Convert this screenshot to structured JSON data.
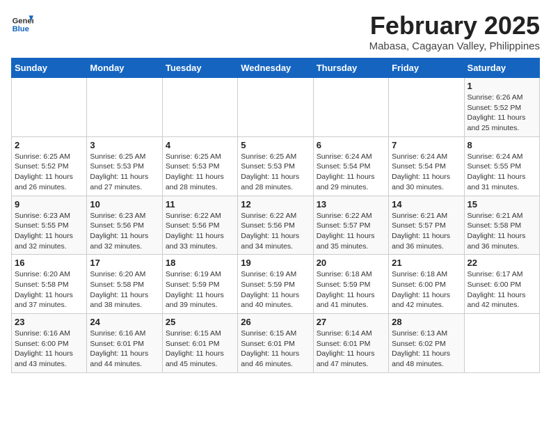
{
  "header": {
    "logo_general": "General",
    "logo_blue": "Blue",
    "title": "February 2025",
    "subtitle": "Mabasa, Cagayan Valley, Philippines"
  },
  "weekdays": [
    "Sunday",
    "Monday",
    "Tuesday",
    "Wednesday",
    "Thursday",
    "Friday",
    "Saturday"
  ],
  "weeks": [
    [
      {
        "day": "",
        "info": ""
      },
      {
        "day": "",
        "info": ""
      },
      {
        "day": "",
        "info": ""
      },
      {
        "day": "",
        "info": ""
      },
      {
        "day": "",
        "info": ""
      },
      {
        "day": "",
        "info": ""
      },
      {
        "day": "1",
        "info": "Sunrise: 6:26 AM\nSunset: 5:52 PM\nDaylight: 11 hours and 25 minutes."
      }
    ],
    [
      {
        "day": "2",
        "info": "Sunrise: 6:25 AM\nSunset: 5:52 PM\nDaylight: 11 hours and 26 minutes."
      },
      {
        "day": "3",
        "info": "Sunrise: 6:25 AM\nSunset: 5:53 PM\nDaylight: 11 hours and 27 minutes."
      },
      {
        "day": "4",
        "info": "Sunrise: 6:25 AM\nSunset: 5:53 PM\nDaylight: 11 hours and 28 minutes."
      },
      {
        "day": "5",
        "info": "Sunrise: 6:25 AM\nSunset: 5:53 PM\nDaylight: 11 hours and 28 minutes."
      },
      {
        "day": "6",
        "info": "Sunrise: 6:24 AM\nSunset: 5:54 PM\nDaylight: 11 hours and 29 minutes."
      },
      {
        "day": "7",
        "info": "Sunrise: 6:24 AM\nSunset: 5:54 PM\nDaylight: 11 hours and 30 minutes."
      },
      {
        "day": "8",
        "info": "Sunrise: 6:24 AM\nSunset: 5:55 PM\nDaylight: 11 hours and 31 minutes."
      }
    ],
    [
      {
        "day": "9",
        "info": "Sunrise: 6:23 AM\nSunset: 5:55 PM\nDaylight: 11 hours and 32 minutes."
      },
      {
        "day": "10",
        "info": "Sunrise: 6:23 AM\nSunset: 5:56 PM\nDaylight: 11 hours and 32 minutes."
      },
      {
        "day": "11",
        "info": "Sunrise: 6:22 AM\nSunset: 5:56 PM\nDaylight: 11 hours and 33 minutes."
      },
      {
        "day": "12",
        "info": "Sunrise: 6:22 AM\nSunset: 5:56 PM\nDaylight: 11 hours and 34 minutes."
      },
      {
        "day": "13",
        "info": "Sunrise: 6:22 AM\nSunset: 5:57 PM\nDaylight: 11 hours and 35 minutes."
      },
      {
        "day": "14",
        "info": "Sunrise: 6:21 AM\nSunset: 5:57 PM\nDaylight: 11 hours and 36 minutes."
      },
      {
        "day": "15",
        "info": "Sunrise: 6:21 AM\nSunset: 5:58 PM\nDaylight: 11 hours and 36 minutes."
      }
    ],
    [
      {
        "day": "16",
        "info": "Sunrise: 6:20 AM\nSunset: 5:58 PM\nDaylight: 11 hours and 37 minutes."
      },
      {
        "day": "17",
        "info": "Sunrise: 6:20 AM\nSunset: 5:58 PM\nDaylight: 11 hours and 38 minutes."
      },
      {
        "day": "18",
        "info": "Sunrise: 6:19 AM\nSunset: 5:59 PM\nDaylight: 11 hours and 39 minutes."
      },
      {
        "day": "19",
        "info": "Sunrise: 6:19 AM\nSunset: 5:59 PM\nDaylight: 11 hours and 40 minutes."
      },
      {
        "day": "20",
        "info": "Sunrise: 6:18 AM\nSunset: 5:59 PM\nDaylight: 11 hours and 41 minutes."
      },
      {
        "day": "21",
        "info": "Sunrise: 6:18 AM\nSunset: 6:00 PM\nDaylight: 11 hours and 42 minutes."
      },
      {
        "day": "22",
        "info": "Sunrise: 6:17 AM\nSunset: 6:00 PM\nDaylight: 11 hours and 42 minutes."
      }
    ],
    [
      {
        "day": "23",
        "info": "Sunrise: 6:16 AM\nSunset: 6:00 PM\nDaylight: 11 hours and 43 minutes."
      },
      {
        "day": "24",
        "info": "Sunrise: 6:16 AM\nSunset: 6:01 PM\nDaylight: 11 hours and 44 minutes."
      },
      {
        "day": "25",
        "info": "Sunrise: 6:15 AM\nSunset: 6:01 PM\nDaylight: 11 hours and 45 minutes."
      },
      {
        "day": "26",
        "info": "Sunrise: 6:15 AM\nSunset: 6:01 PM\nDaylight: 11 hours and 46 minutes."
      },
      {
        "day": "27",
        "info": "Sunrise: 6:14 AM\nSunset: 6:01 PM\nDaylight: 11 hours and 47 minutes."
      },
      {
        "day": "28",
        "info": "Sunrise: 6:13 AM\nSunset: 6:02 PM\nDaylight: 11 hours and 48 minutes."
      },
      {
        "day": "",
        "info": ""
      }
    ]
  ]
}
